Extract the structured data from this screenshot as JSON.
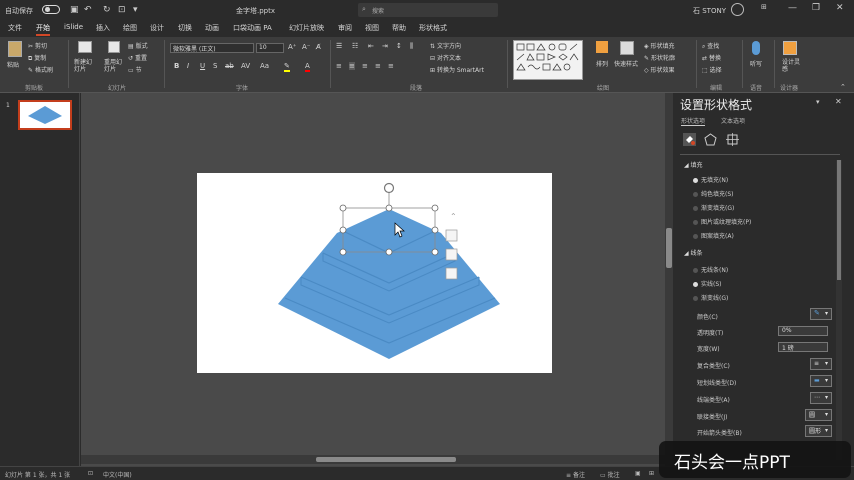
{
  "titlebar": {
    "autosave_label": "自动保存",
    "autosave_state": "关",
    "filename": "金字塔.pptx",
    "search_placeholder": "搜索",
    "user_name": "石 STONY",
    "user_initials": "石",
    "ribbon_toggle_icon": "ribbon-display-icon",
    "minimize_icon": "minimize-icon",
    "restore_icon": "restore-icon",
    "close_icon": "close-icon"
  },
  "tabs": [
    {
      "label": "文件"
    },
    {
      "label": "开始",
      "active": true
    },
    {
      "label": "iSlide"
    },
    {
      "label": "插入"
    },
    {
      "label": "绘图"
    },
    {
      "label": "设计"
    },
    {
      "label": "切换"
    },
    {
      "label": "动画"
    },
    {
      "label": "口袋动画 PA"
    },
    {
      "label": "幻灯片放映"
    },
    {
      "label": "审阅"
    },
    {
      "label": "视图"
    },
    {
      "label": "帮助"
    },
    {
      "label": "形状格式"
    }
  ],
  "header_actions": {
    "share": "共享",
    "comment": "批注"
  },
  "ribbon": {
    "clipboard": {
      "paste": "粘贴",
      "cut": "剪切",
      "copy": "复制",
      "format_painter": "格式刷",
      "label": "剪贴板"
    },
    "slides": {
      "new_slide": "新建幻灯片",
      "reuse": "重用幻灯片",
      "layout": "版式",
      "reset": "重置",
      "section": "节",
      "label": "幻灯片"
    },
    "font": {
      "font_name": "微软雅黑 (正文)",
      "font_size": "10",
      "label": "字体"
    },
    "paragraph": {
      "text_direction": "文字方向",
      "align_text": "对齐文本",
      "smartart": "转换为 SmartArt",
      "label": "段落"
    },
    "drawing": {
      "arrange": "排列",
      "quick_styles": "快速样式",
      "shape_fill": "形状填充",
      "shape_outline": "形状轮廓",
      "shape_effects": "形状效果",
      "label": "绘图"
    },
    "editing": {
      "find": "查找",
      "replace": "替换",
      "select": "选择",
      "label": "编辑"
    },
    "voice": {
      "dictate": "听写",
      "label": "语音"
    },
    "designer": {
      "design_ideas": "设计灵感",
      "label": "设计器"
    }
  },
  "slide_panel": {
    "slide_number": "1"
  },
  "format_pane": {
    "title": "设置形状格式",
    "subtabs": [
      "形状选项",
      "文本选项"
    ],
    "fill_section": "填充",
    "fill_options": [
      {
        "label": "无填充(N)",
        "selected": true
      },
      {
        "label": "纯色填充(S)",
        "selected": false
      },
      {
        "label": "渐变填充(G)",
        "selected": false
      },
      {
        "label": "图片或纹理填充(P)",
        "selected": false
      },
      {
        "label": "图案填充(A)",
        "selected": false
      }
    ],
    "line_section": "线条",
    "line_options": [
      {
        "label": "无线条(N)",
        "selected": false
      },
      {
        "label": "实线(S)",
        "selected": true
      },
      {
        "label": "渐变线(G)",
        "selected": false
      }
    ],
    "props": [
      {
        "label": "颜色(C)",
        "value": ""
      },
      {
        "label": "透明度(T)",
        "value": "0%"
      },
      {
        "label": "宽度(W)",
        "value": "1 磅"
      },
      {
        "label": "复合类型(C)",
        "value": ""
      },
      {
        "label": "短划线类型(D)",
        "value": ""
      },
      {
        "label": "线端类型(A)",
        "value": ""
      },
      {
        "label": "联接类型(J)",
        "value": ""
      },
      {
        "label": "开始箭头类型(B)",
        "value": ""
      }
    ],
    "join_type_value": "圆形",
    "line_end_value": "圆"
  },
  "statusbar": {
    "slide_info": "幻灯片 第 1 张，共 1 张",
    "language": "中文(中国)",
    "notes": "备注",
    "comments": "批注"
  },
  "watermark": "石头会一点PPT",
  "colors": {
    "accent": "#d24726",
    "pyramid": "#5b9bd5",
    "pyramid_dark": "#4a8ac4"
  }
}
